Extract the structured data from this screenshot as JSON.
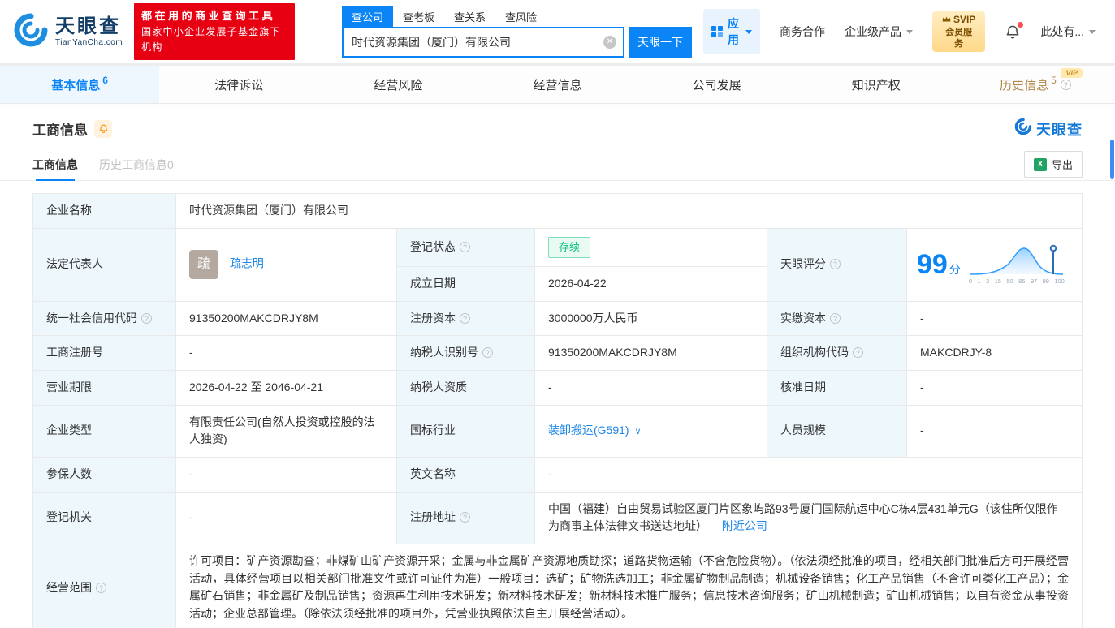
{
  "header": {
    "logo": {
      "name_cn": "天眼查",
      "name_en": "TianYanCha.com"
    },
    "slogan_line1": "都在用的商业查询工具",
    "slogan_line2": "国家中小企业发展子基金旗下机构",
    "search": {
      "tabs": [
        {
          "label": "查公司"
        },
        {
          "label": "查老板"
        },
        {
          "label": "查关系"
        },
        {
          "label": "查风险"
        }
      ],
      "value": "时代资源集团（厦门）有限公司",
      "button_label": "天眼一下"
    },
    "menu": {
      "apps_label": "应用",
      "cooperation_label": "商务合作",
      "enterprise_label": "企业级产品",
      "svip_line1": "SVIP",
      "svip_line2": "会员服务",
      "profile_label": "此处有..."
    }
  },
  "nav_tabs": [
    {
      "label": "基本信息",
      "count": "6"
    },
    {
      "label": "法律诉讼"
    },
    {
      "label": "经营风险"
    },
    {
      "label": "经营信息"
    },
    {
      "label": "公司发展"
    },
    {
      "label": "知识产权"
    },
    {
      "label": "历史信息",
      "count": "5",
      "vip": "VIP"
    }
  ],
  "section": {
    "title": "工商信息",
    "brand_logo": "天眼查",
    "subtab_current": "工商信息",
    "subtab_history": "历史工商信息0",
    "export_label": "导出",
    "export_icon": "X"
  },
  "fields": {
    "company_name": {
      "label": "企业名称",
      "value": "时代资源集团（厦门）有限公司"
    },
    "legal_rep": {
      "label": "法定代表人",
      "avatar_char": "疏",
      "value": "疏志明"
    },
    "reg_status": {
      "label": "登记状态",
      "value": "存续"
    },
    "est_date": {
      "label": "成立日期",
      "value": "2026-04-22"
    },
    "score": {
      "label": "天眼评分",
      "value": "99",
      "unit": "分",
      "ticks": [
        "0",
        "1",
        "3",
        "15",
        "50",
        "85",
        "97",
        "99",
        "100"
      ]
    },
    "credit_code": {
      "label": "统一社会信用代码",
      "value": "91350200MAKCDRJY8M"
    },
    "reg_capital": {
      "label": "注册资本",
      "value": "3000000万人民币"
    },
    "paid_capital": {
      "label": "实缴资本",
      "value": "-"
    },
    "reg_number": {
      "label": "工商注册号",
      "value": "-"
    },
    "taxpayer_id": {
      "label": "纳税人识别号",
      "value": "91350200MAKCDRJY8M"
    },
    "org_code": {
      "label": "组织机构代码",
      "value": "MAKCDRJY-8"
    },
    "business_term": {
      "label": "营业期限",
      "value": "2026-04-22 至 2046-04-21"
    },
    "taxpayer_quality": {
      "label": "纳税人资质",
      "value": "-"
    },
    "approval_date": {
      "label": "核准日期",
      "value": "-"
    },
    "company_type": {
      "label": "企业类型",
      "value": "有限责任公司(自然人投资或控股的法人独资)"
    },
    "industry": {
      "label": "国标行业",
      "value": "装卸搬运(G591)"
    },
    "staff_size": {
      "label": "人员规模",
      "value": "-"
    },
    "insured_count": {
      "label": "参保人数",
      "value": "-"
    },
    "english_name": {
      "label": "英文名称",
      "value": "-"
    },
    "reg_authority": {
      "label": "登记机关",
      "value": "-"
    },
    "address": {
      "label": "注册地址",
      "value": "中国（福建）自由贸易试验区厦门片区象屿路93号厦门国际航运中心C栋4层431单元G（该住所仅限作为商事主体法律文书送达地址）",
      "nearby_link": "附近公司"
    },
    "business_scope": {
      "label": "经营范围",
      "value": "许可项目：矿产资源勘查；非煤矿山矿产资源开采；金属与非金属矿产资源地质勘探；道路货物运输（不含危险货物）。（依法须经批准的项目，经相关部门批准后方可开展经营活动，具体经营项目以相关部门批准文件或许可证件为准）一般项目：选矿；矿物洗选加工；非金属矿物制品制造；机械设备销售；化工产品销售（不含许可类化工产品）；金属矿石销售；非金属矿及制品销售；资源再生利用技术研发；新材料技术研发；新材料技术推广服务；信息技术咨询服务；矿山机械制造；矿山机械销售；以自有资金从事投资活动；企业总部管理。（除依法须经批准的项目外，凭营业执照依法自主开展经营活动）。"
    }
  }
}
